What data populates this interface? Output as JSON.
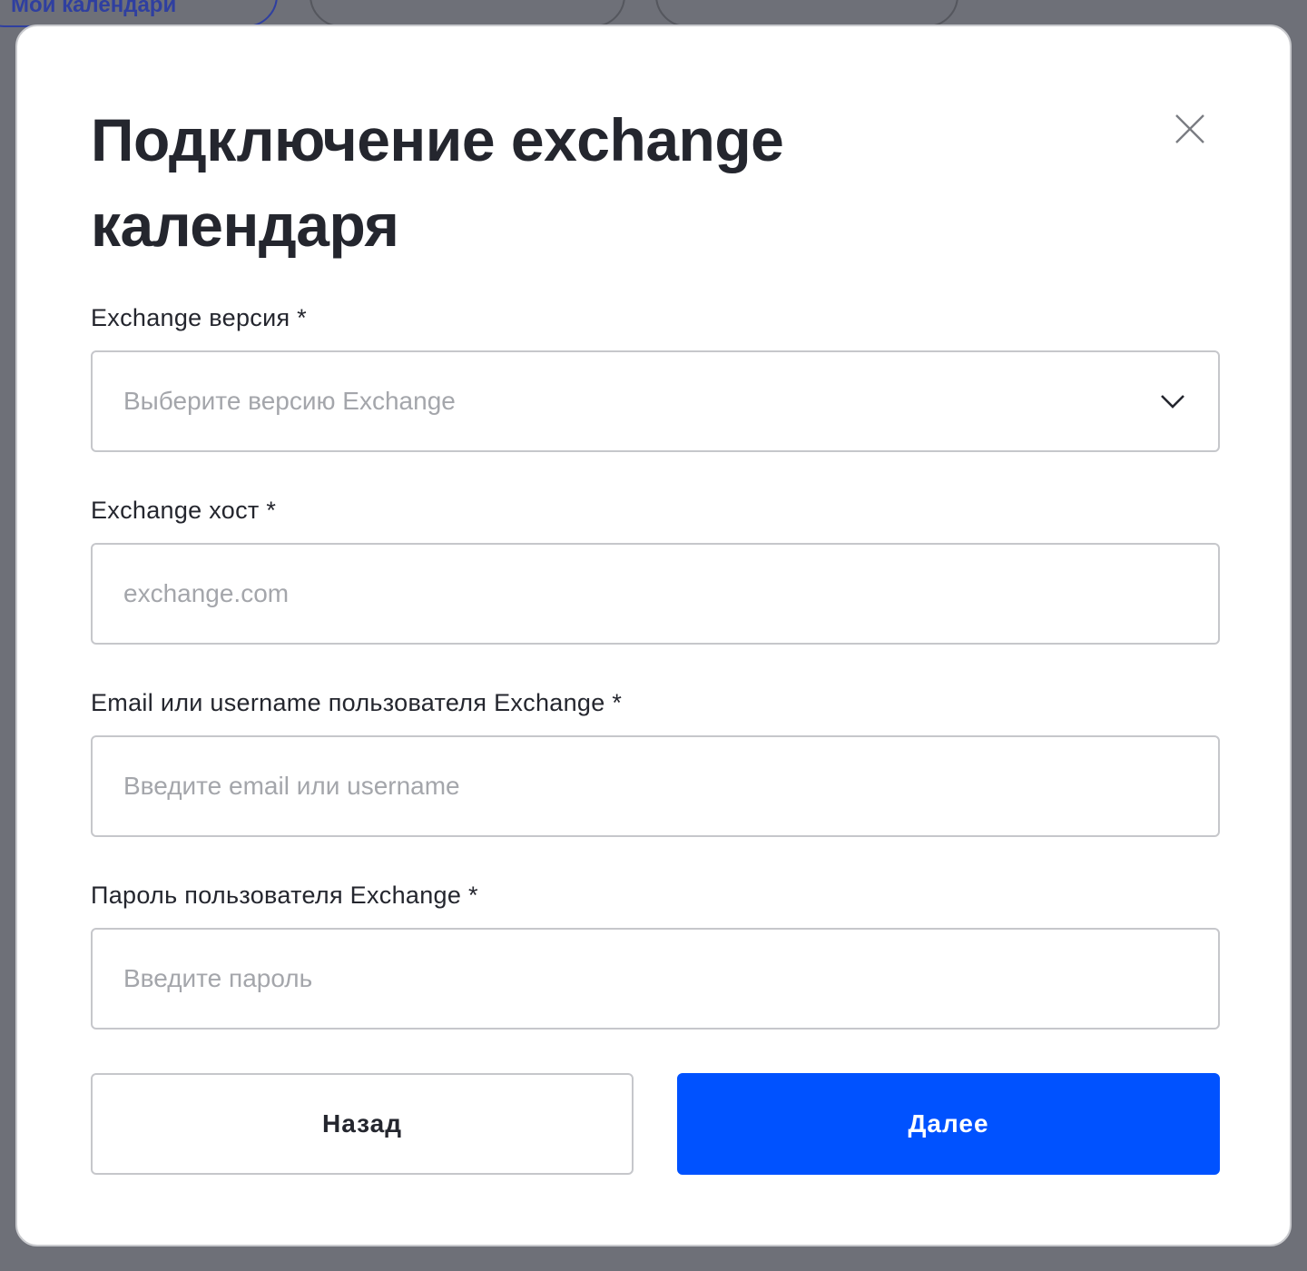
{
  "background": {
    "tabs": [
      {
        "label": "Мои календари",
        "active": true
      },
      {
        "label": "",
        "active": false
      },
      {
        "label": "",
        "active": false
      }
    ]
  },
  "modal": {
    "title": "Подключение exchange календаря",
    "close_icon": "close-icon",
    "fields": {
      "version": {
        "label": "Exchange версия *",
        "placeholder": "Выберите версию Exchange",
        "icon": "chevron-down-icon"
      },
      "host": {
        "label": "Exchange хост *",
        "placeholder": "exchange.com",
        "value": ""
      },
      "username": {
        "label": "Email или username пользователя Exchange *",
        "placeholder": "Введите email или username",
        "value": ""
      },
      "password": {
        "label": "Пароль пользователя Exchange *",
        "placeholder": "Введите пароль",
        "value": ""
      }
    },
    "buttons": {
      "back": "Назад",
      "next": "Далее"
    }
  },
  "colors": {
    "primary": "#0052ff",
    "text": "#24262e",
    "placeholder": "#a4a6ab",
    "overlay": "#6e7078"
  }
}
